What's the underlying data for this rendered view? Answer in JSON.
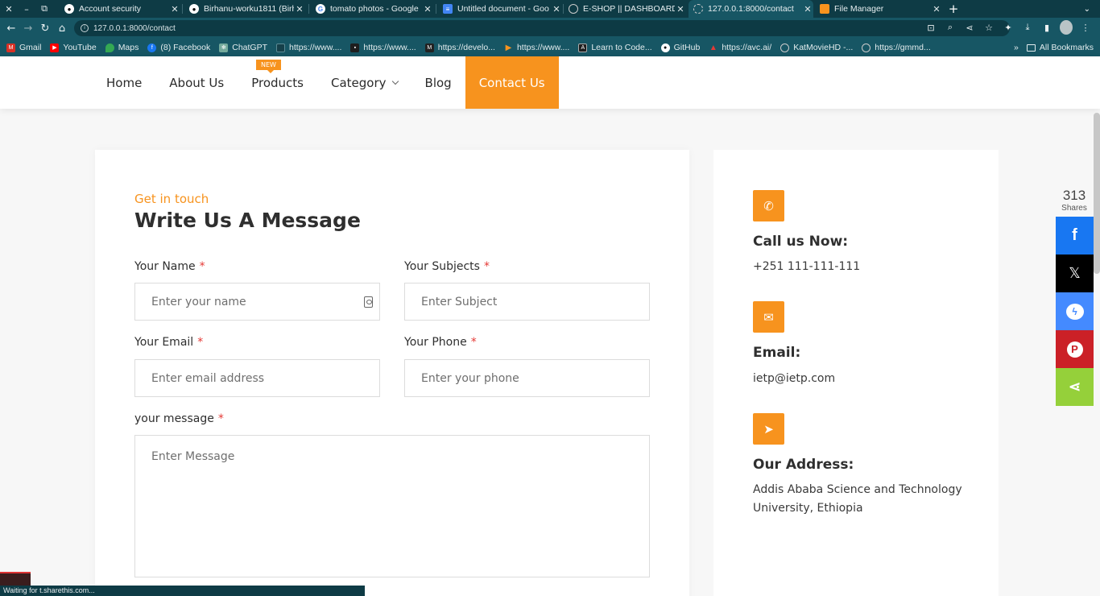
{
  "browser": {
    "tabs": [
      {
        "title": "Account security",
        "icon": "github-icon",
        "color": "#ffffff"
      },
      {
        "title": "Birhanu-worku1811 (Birh",
        "icon": "github-icon",
        "color": "#ffffff"
      },
      {
        "title": "tomato photos - Google",
        "icon": "google-icon",
        "color": "#ffffff"
      },
      {
        "title": "Untitled document - Goo",
        "icon": "docs-icon",
        "color": "#4285f4"
      },
      {
        "title": "E-SHOP || DASHBOARD",
        "icon": "globe-icon",
        "color": "#cccccc"
      },
      {
        "title": "127.0.0.1:8000/contact",
        "icon": "loading-icon",
        "color": "#cccccc",
        "active": true
      },
      {
        "title": "File Manager",
        "icon": "file-manager-icon",
        "color": "#f7931e"
      }
    ],
    "url": "127.0.0.1:8000/contact",
    "bookmarks": [
      {
        "label": "Gmail",
        "icon": "gmail-icon",
        "color": "#d93025"
      },
      {
        "label": "YouTube",
        "icon": "youtube-icon",
        "color": "#ff0000"
      },
      {
        "label": "Maps",
        "icon": "maps-icon",
        "color": "#34a853"
      },
      {
        "label": "(8) Facebook",
        "icon": "facebook-icon",
        "color": "#1877f2"
      },
      {
        "label": "ChatGPT",
        "icon": "chatgpt-icon",
        "color": "#74aa9c"
      },
      {
        "label": "https://www....",
        "icon": "page-icon",
        "color": "#16404a"
      },
      {
        "label": "https://www....",
        "icon": "page-icon",
        "color": "#1e1e1e"
      },
      {
        "label": "https://develo...",
        "icon": "page-icon",
        "color": "#222222"
      },
      {
        "label": "https://www....",
        "icon": "play-icon",
        "color": "#f7931e"
      },
      {
        "label": "Learn to Code...",
        "icon": "code-icon",
        "color": "#1e1e1e"
      },
      {
        "label": "GitHub",
        "icon": "github-icon",
        "color": "#ffffff"
      },
      {
        "label": "https://avc.ai/",
        "icon": "avc-icon",
        "color": "#e53935"
      },
      {
        "label": "KatMovieHD -...",
        "icon": "globe-icon",
        "color": "#cccccc"
      },
      {
        "label": "https://gmmd...",
        "icon": "globe-icon",
        "color": "#cccccc"
      }
    ],
    "all_bookmarks": "All Bookmarks",
    "status": "Waiting for t.sharethis.com..."
  },
  "menu": {
    "items": [
      "Home",
      "About Us",
      "Products",
      "Category",
      "Blog",
      "Contact Us"
    ],
    "badge": "NEW"
  },
  "form": {
    "eyebrow": "Get in touch",
    "heading": "Write Us A Message",
    "name_label": "Your Name",
    "name_placeholder": "Enter your name",
    "subject_label": "Your Subjects",
    "subject_placeholder": "Enter Subject",
    "email_label": "Your Email",
    "email_placeholder": "Enter email address",
    "phone_label": "Your Phone",
    "phone_placeholder": "Enter your phone",
    "message_label": "your message",
    "message_placeholder": "Enter Message",
    "required_mark": "*"
  },
  "info": {
    "call_title": "Call us Now:",
    "call_value": "+251 111-111-111",
    "email_title": "Email:",
    "email_value": "ietp@ietp.com",
    "address_title": "Our Address:",
    "address_value": "Addis Ababa Science and Technology University, Ethiopia"
  },
  "share": {
    "count": "313",
    "label": "Shares",
    "buttons": [
      {
        "name": "facebook",
        "color": "#1877f2",
        "glyph": "f"
      },
      {
        "name": "x",
        "color": "#000000",
        "glyph": "X"
      },
      {
        "name": "messenger",
        "color": "#448aff",
        "glyph": "m"
      },
      {
        "name": "pinterest",
        "color": "#cb2027",
        "glyph": "P"
      },
      {
        "name": "sharethis",
        "color": "#95d03a",
        "glyph": "<"
      }
    ]
  },
  "colors": {
    "accent": "#f7931e",
    "chrome": "#175664"
  }
}
